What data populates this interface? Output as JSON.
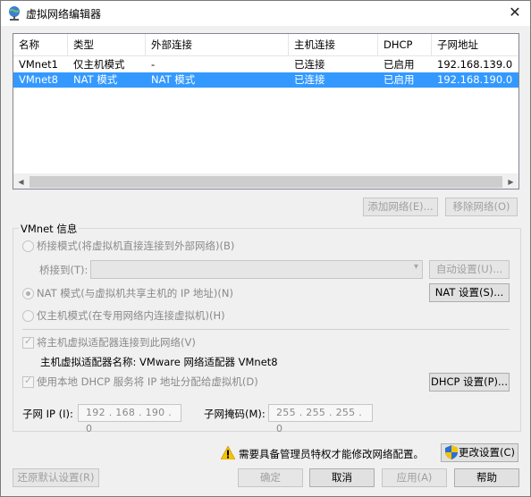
{
  "window": {
    "title": "虚拟网络编辑器",
    "close_glyph": "✕"
  },
  "table": {
    "headers": [
      "名称",
      "类型",
      "外部连接",
      "主机连接",
      "DHCP",
      "子网地址"
    ],
    "rows": [
      [
        "VMnet1",
        "仅主机模式",
        "-",
        "已连接",
        "已启用",
        "192.168.139.0"
      ],
      [
        "VMnet8",
        "NAT 模式",
        "NAT 模式",
        "已连接",
        "已启用",
        "192.168.190.0"
      ]
    ],
    "selected_row": 1
  },
  "list_buttons": {
    "add": "添加网络(E)...",
    "remove": "移除网络(O)"
  },
  "vmnet_info": {
    "group_label": "VMnet 信息",
    "bridged_label": "桥接模式(将虚拟机直接连接到外部网络)(B)",
    "bridge_to_label": "桥接到(T):",
    "bridge_to_value": "",
    "auto_settings": "自动设置(U)...",
    "nat_label": "NAT 模式(与虚拟机共享主机的 IP 地址)(N)",
    "nat_settings": "NAT 设置(S)...",
    "hostonly_label": "仅主机模式(在专用网络内连接虚拟机)(H)",
    "connect_adapter_label": "将主机虚拟适配器连接到此网络(V)",
    "adapter_name_label": "主机虚拟适配器名称: VMware 网络适配器 VMnet8",
    "dhcp_label": "使用本地 DHCP 服务将 IP 地址分配给虚拟机(D)",
    "dhcp_settings": "DHCP 设置(P)...",
    "subnet_ip_label": "子网 IP (I):",
    "subnet_ip_value": "192 . 168 . 190 .  0",
    "subnet_mask_label": "子网掩码(M):",
    "subnet_mask_value": "255 . 255 . 255 .  0",
    "selected_mode": "nat",
    "connect_adapter_checked": true,
    "dhcp_checked": true
  },
  "footer": {
    "warning_text": "需要具备管理员特权才能修改网络配置。",
    "change_settings": "更改设置(C)",
    "restore_defaults": "还原默认设置(R)",
    "ok": "确定",
    "cancel": "取消",
    "apply": "应用(A)",
    "help": "帮助"
  },
  "colors": {
    "selection": "#3399ff",
    "warning": "#f5c400",
    "shield_blue": "#2a6fd6"
  },
  "icons": {
    "app": "network-globe-icon",
    "warning": "warning-icon",
    "shield": "uac-shield-icon"
  }
}
